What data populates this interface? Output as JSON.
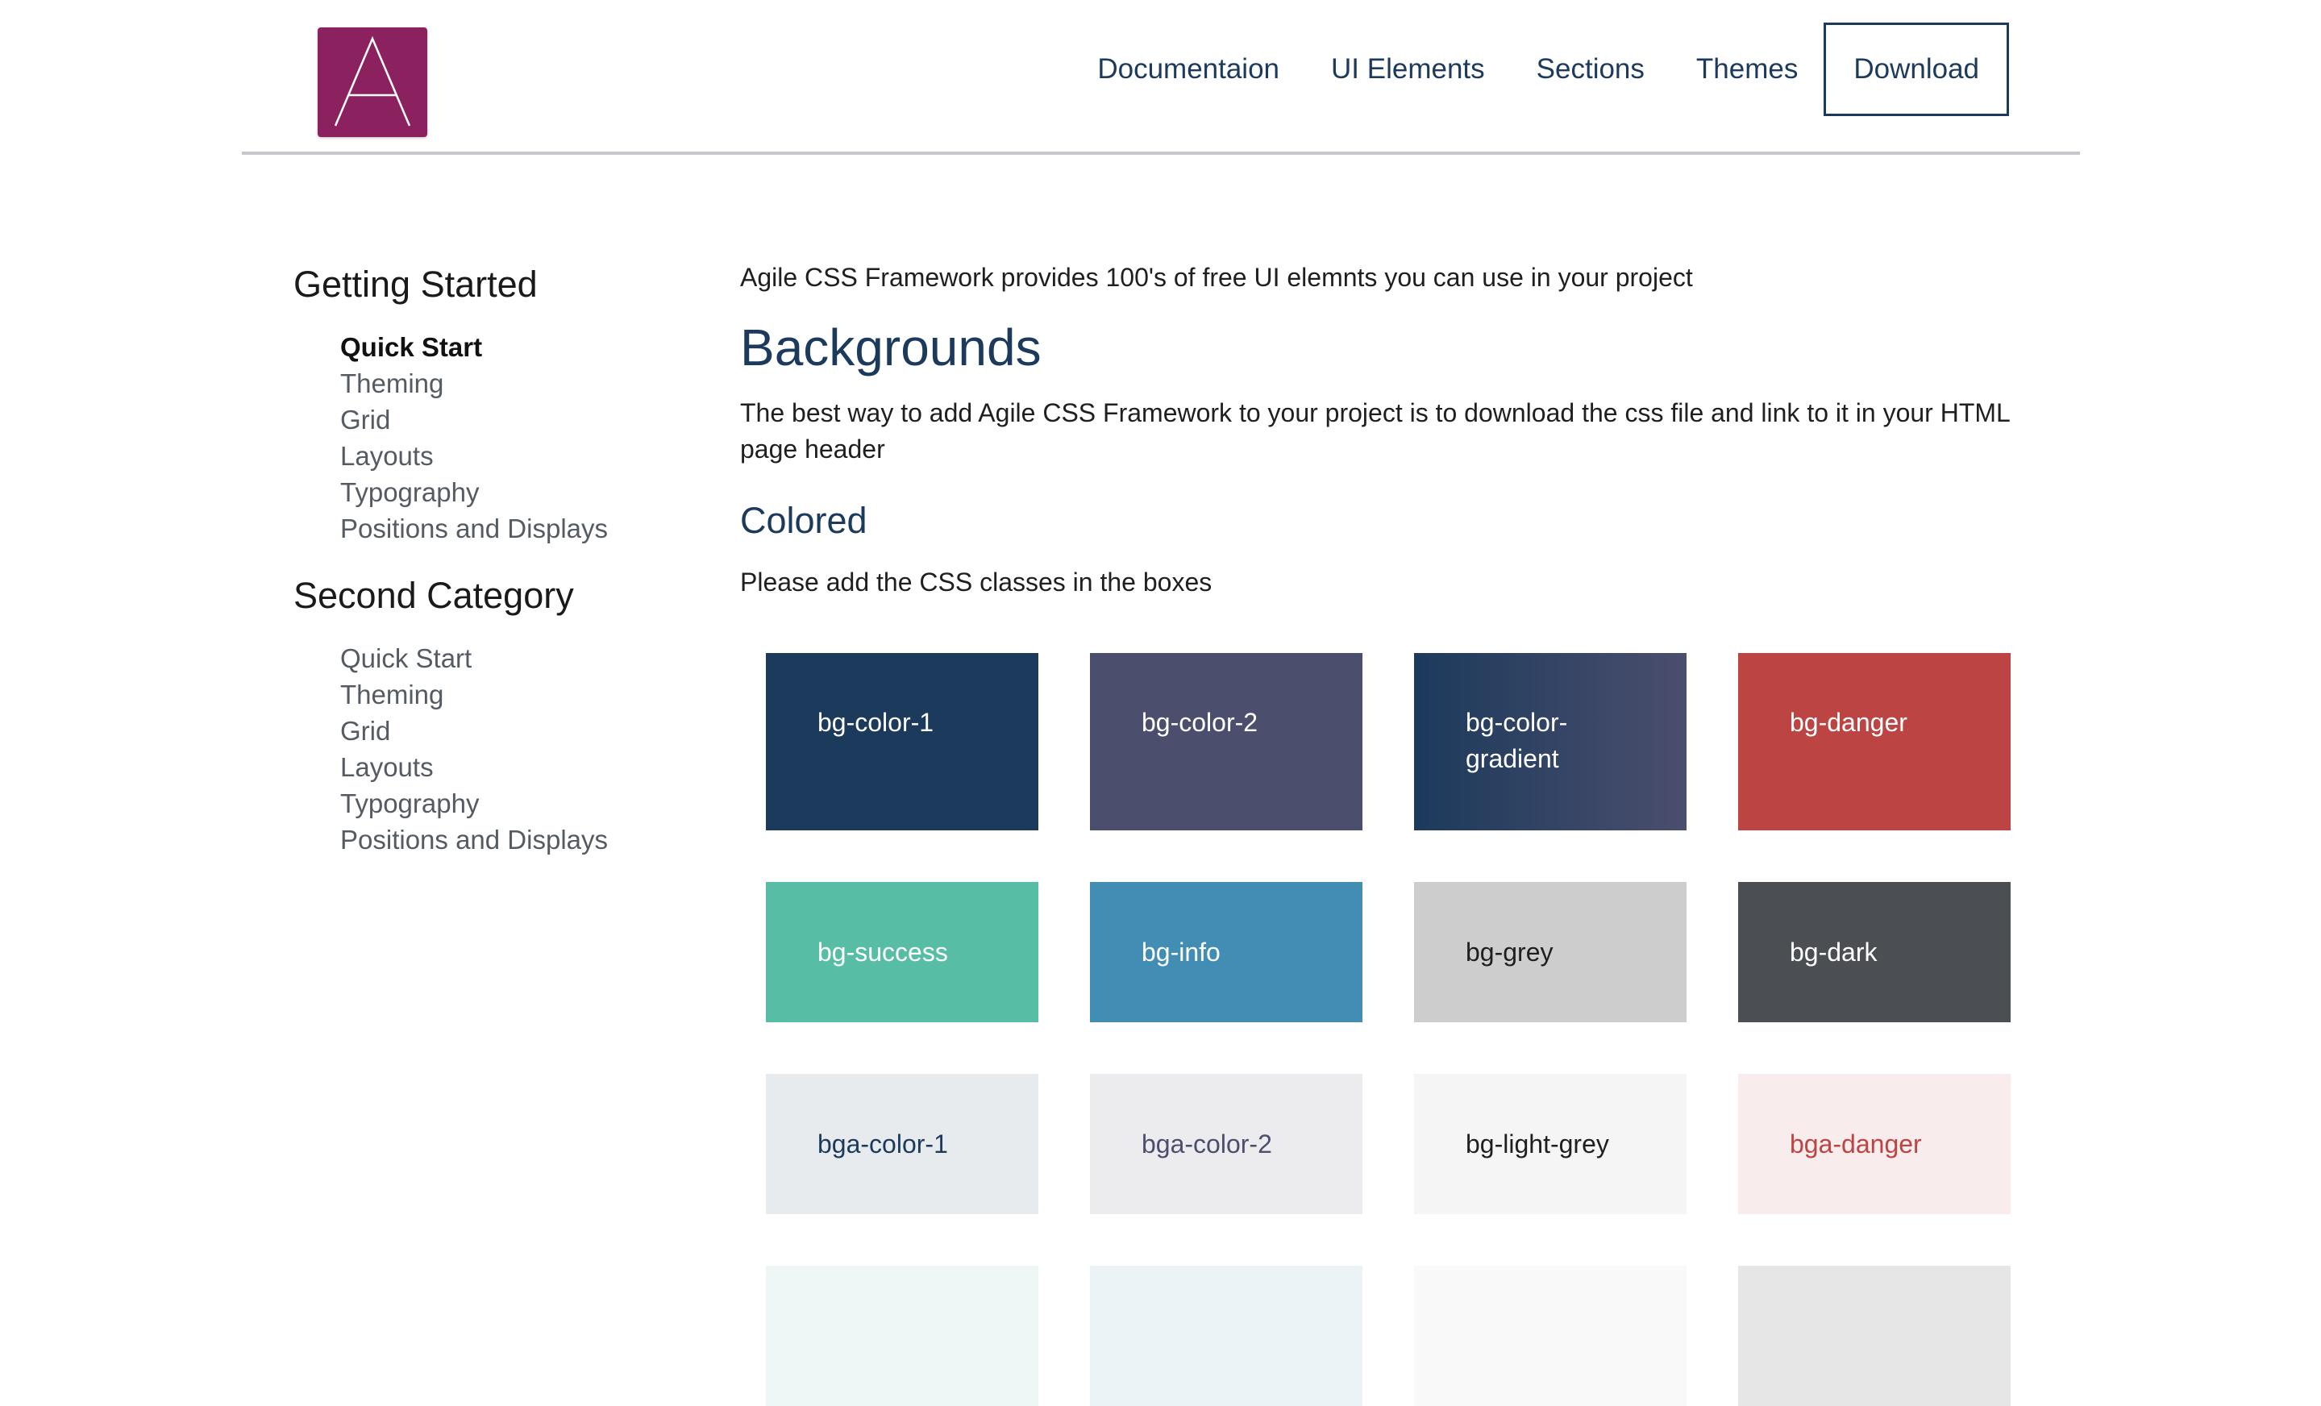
{
  "header": {
    "logo_letter": "A",
    "nav": [
      "Documentaion",
      "UI Elements",
      "Sections",
      "Themes"
    ],
    "download_label": "Download"
  },
  "sidebar": {
    "groups": [
      {
        "heading": "Getting Started",
        "items": [
          "Quick Start",
          "Theming",
          "Grid",
          "Layouts",
          "Typography",
          "Positions and Displays"
        ],
        "active_index": 0
      },
      {
        "heading": "Second Category",
        "items": [
          "Quick Start",
          "Theming",
          "Grid",
          "Layouts",
          "Typography",
          "Positions and Displays"
        ]
      }
    ]
  },
  "main": {
    "intro": "Agile CSS Framework provides 100's of free UI elemnts you can use in your project",
    "title": "Backgrounds",
    "lead": "The best way to add Agile CSS Framework to your project is to download the css file and link to it in your HTML page header",
    "subtitle": "Colored",
    "note": "Please add the CSS classes in the boxes"
  },
  "swatches": [
    {
      "label": "bg-color-1",
      "bg": "#1c3a5c",
      "fg": "#ffffff"
    },
    {
      "label": "bg-color-2",
      "bg": "#4b4e6d",
      "fg": "#ffffff"
    },
    {
      "label": "bg-color-gradient",
      "bg": "linear-gradient(90deg, #1c3a5c 0%, #4b4e6d 100%)",
      "fg": "#ffffff"
    },
    {
      "label": "bg-danger",
      "bg": "#bc4442",
      "fg": "#ffffff"
    },
    {
      "label": "bg-success",
      "bg": "#57bea5",
      "fg": "#ffffff"
    },
    {
      "label": "bg-info",
      "bg": "#418db4",
      "fg": "#ffffff"
    },
    {
      "label": "bg-grey",
      "bg": "#cdcdcd",
      "fg": "#1f1f1f"
    },
    {
      "label": "bg-dark",
      "bg": "#4b4f54",
      "fg": "#ffffff"
    },
    {
      "label": "bga-color-1",
      "bg": "#e8ebee",
      "fg": "#1c3a5c"
    },
    {
      "label": "bga-color-2",
      "bg": "#ececee",
      "fg": "#4b4e6d"
    },
    {
      "label": "bg-light-grey",
      "bg": "#f5f5f5",
      "fg": "#1f1f1f"
    },
    {
      "label": "bga-danger",
      "bg": "#f8ecec",
      "fg": "#bc4442"
    },
    {
      "label": "",
      "bg": "#eef7f5",
      "fg": "#57bea5"
    },
    {
      "label": "",
      "bg": "#ecf3f7",
      "fg": "#418db4"
    },
    {
      "label": "",
      "bg": "#f9f9f9",
      "fg": "#1f1f1f"
    },
    {
      "label": "",
      "bg": "#e6e6e7",
      "fg": "#4b4f54"
    }
  ]
}
